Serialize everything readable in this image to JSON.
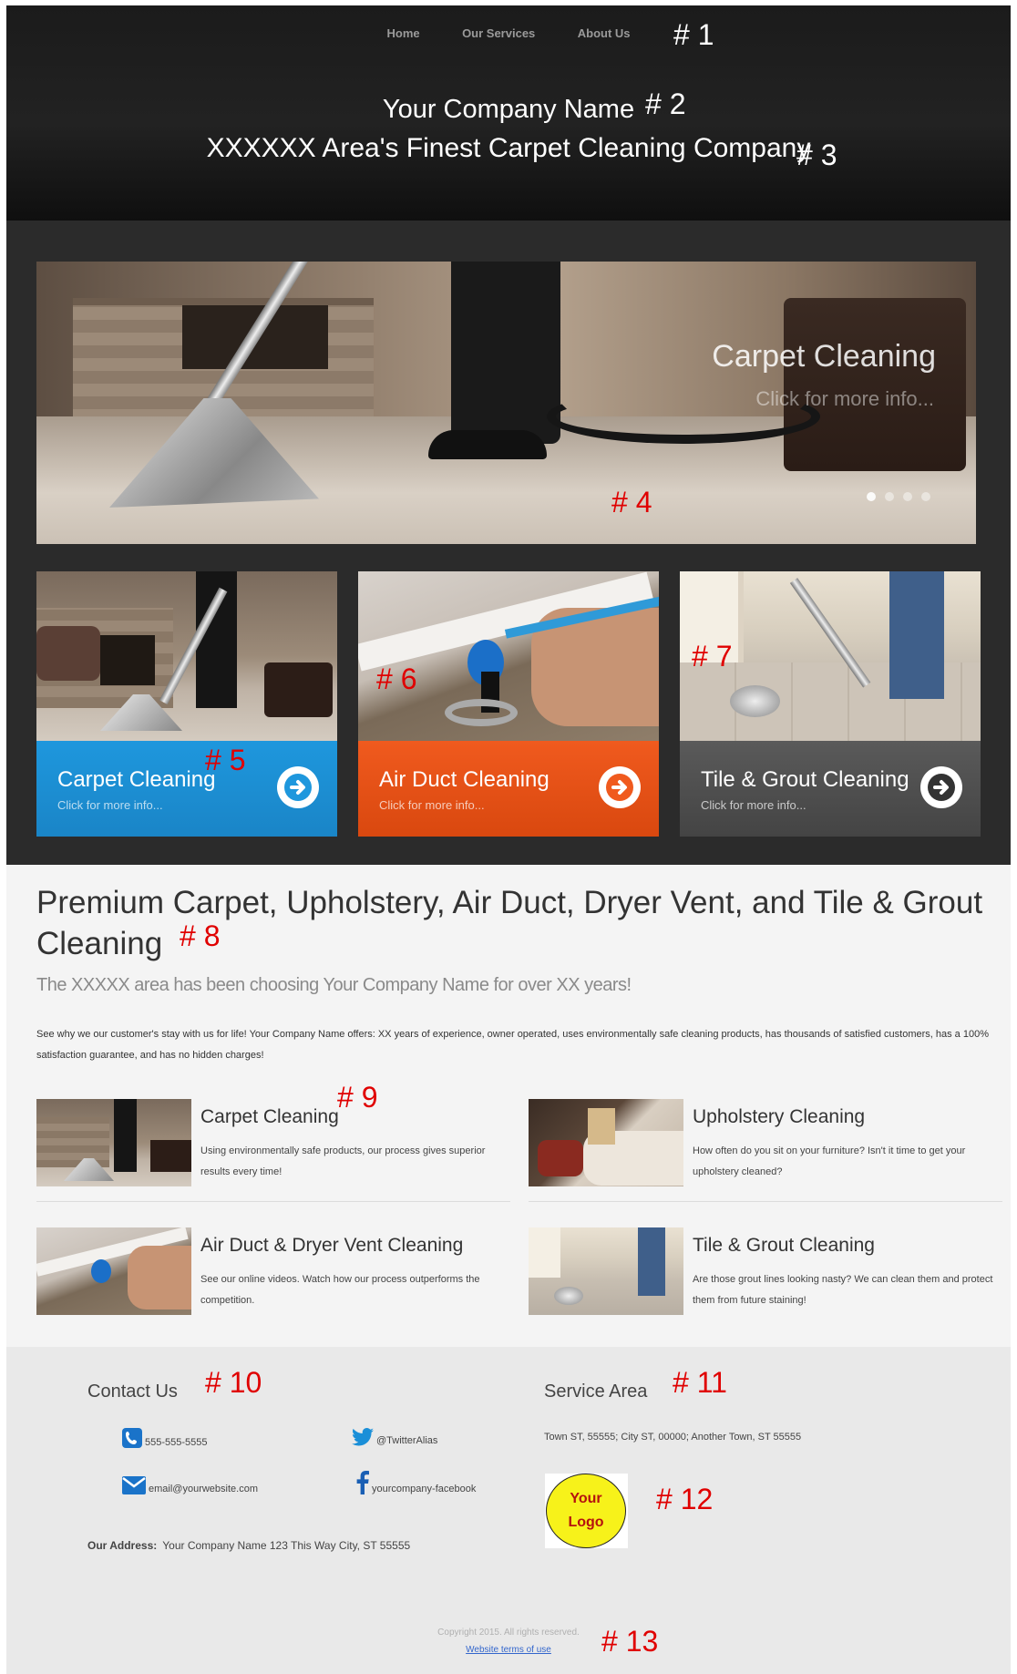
{
  "nav": {
    "items": [
      "Home",
      "Our Services",
      "About Us"
    ]
  },
  "header": {
    "company_name": "Your Company Name",
    "tagline": "XXXXXX Area's Finest Carpet Cleaning Company"
  },
  "hero": {
    "title": "Carpet Cleaning",
    "subtitle": "Click for more info...",
    "slide_count": 4,
    "active_slide": 1
  },
  "tiles": [
    {
      "title": "Carpet Cleaning",
      "subtitle": "Click for more info...",
      "color": "#1e97dd"
    },
    {
      "title": "Air Duct Cleaning",
      "subtitle": "Click for more info...",
      "color": "#f05a1e"
    },
    {
      "title": "Tile & Grout Cleaning",
      "subtitle": "Click for more info...",
      "color": "#555555"
    }
  ],
  "content": {
    "heading": "Premium Carpet, Upholstery, Air Duct, Dryer Vent, and Tile & Grout Cleaning",
    "lead": "The XXXXX area has been choosing Your Company Name for over XX years!",
    "body": "See why we our customer's stay with us for life! Your Company Name offers: XX years of experience, owner operated, uses environmentally safe cleaning products, has thousands of satisfied customers, has a 100% satisfaction guarantee, and has no hidden charges!"
  },
  "services": [
    {
      "title": "Carpet Cleaning",
      "text": "Using environmentally safe products, our process gives superior results every time!"
    },
    {
      "title": "Upholstery Cleaning",
      "text": "How often do you sit on your furniture? Isn't it time to get your upholstery cleaned?"
    },
    {
      "title": "Air Duct & Dryer Vent Cleaning",
      "text": "See our online videos. Watch how our process outperforms the competition."
    },
    {
      "title": "Tile & Grout Cleaning",
      "text": "Are those grout lines looking nasty? We can clean them and protect them from future staining!"
    }
  ],
  "footer": {
    "contact_heading": "Contact Us",
    "phone": "555-555-5555",
    "twitter": "@TwitterAlias",
    "email": "email@yourwebsite.com",
    "facebook": "yourcompany-facebook",
    "address_label": "Our Address:",
    "address": "Your Company Name 123 This Way City, ST 55555",
    "service_heading": "Service Area",
    "service_area": "Town ST, 55555; City ST, 00000; Another Town, ST 55555",
    "logo_line1": "Your",
    "logo_line2": "Logo",
    "copyright": "Copyright 2015. All rights reserved.",
    "terms": "Website terms of use"
  },
  "annotations": [
    "# 1",
    "# 2",
    "# 3",
    "# 4",
    "# 5",
    "# 6",
    "# 7",
    "# 8",
    "# 9",
    "# 10",
    "# 11",
    "# 12",
    "# 13"
  ],
  "colors": {
    "accent_blue": "#1e97dd",
    "accent_orange": "#f05a1e",
    "accent_gray": "#555555",
    "annotation_red": "#e00000",
    "link_blue": "#3366cc"
  }
}
